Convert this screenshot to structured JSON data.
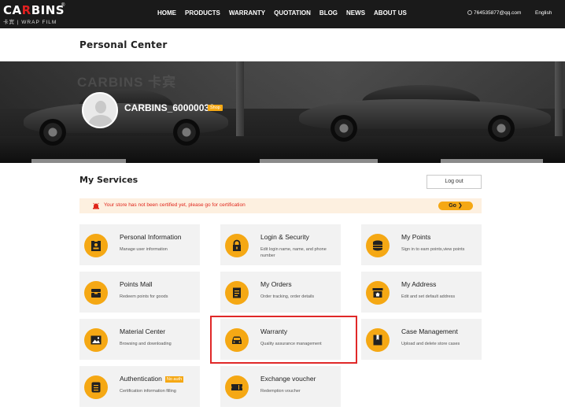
{
  "brand": {
    "name_white": "CA",
    "name_red": "R",
    "name_rest": "BINS",
    "reg": "®",
    "sub": "卡宾 | WRAP FILM"
  },
  "nav": {
    "items": [
      "HOME",
      "PRODUCTS",
      "WARRANTY",
      "QUOTATION",
      "BLOG",
      "NEWS",
      "ABOUT US"
    ]
  },
  "user": {
    "email": "764535877@qq.com",
    "language": "English"
  },
  "page_title": "Personal  Center",
  "banner": {
    "bg_text": "CARBINS 卡宾",
    "username": "CARBINS_60000032",
    "badge": "Shop"
  },
  "services": {
    "title": "My  Services",
    "logout_label": "Log out",
    "notice": "Your store has not been certified yet, please go for certification",
    "go_label": "Go  ❯",
    "cards": [
      {
        "title": "Personal Information",
        "desc": "Manage user information",
        "icon": "id-card-icon"
      },
      {
        "title": "Login & Security",
        "desc": "Edit login name, name, and phone number",
        "icon": "lock-icon"
      },
      {
        "title": "My Points",
        "desc": "Sign in to earn points,view points",
        "icon": "coins-icon"
      },
      {
        "title": "Points Mall",
        "desc": "Redeem points for goods",
        "icon": "shop-icon"
      },
      {
        "title": "My Orders",
        "desc": "Order tracking, order details",
        "icon": "document-icon"
      },
      {
        "title": "My Address",
        "desc": "Edit and set default address",
        "icon": "home-icon"
      },
      {
        "title": "Material Center",
        "desc": "Browsing and downloading",
        "icon": "image-icon"
      },
      {
        "title": "Warranty",
        "desc": "Quality assurance management",
        "icon": "car-icon"
      },
      {
        "title": "Case Management",
        "desc": "Upload and delete store cases",
        "icon": "bookmark-icon"
      },
      {
        "title": "Authentication",
        "desc": "Certification information filling",
        "icon": "certificate-icon",
        "badge": "No auth"
      },
      {
        "title": "Exchange voucher",
        "desc": "Redemption voucher",
        "icon": "ticket-icon"
      }
    ]
  },
  "colors": {
    "accent": "#f5a814",
    "nav_bg": "#1a1a1a",
    "alert": "#e0261c",
    "highlight": "#e02828"
  }
}
